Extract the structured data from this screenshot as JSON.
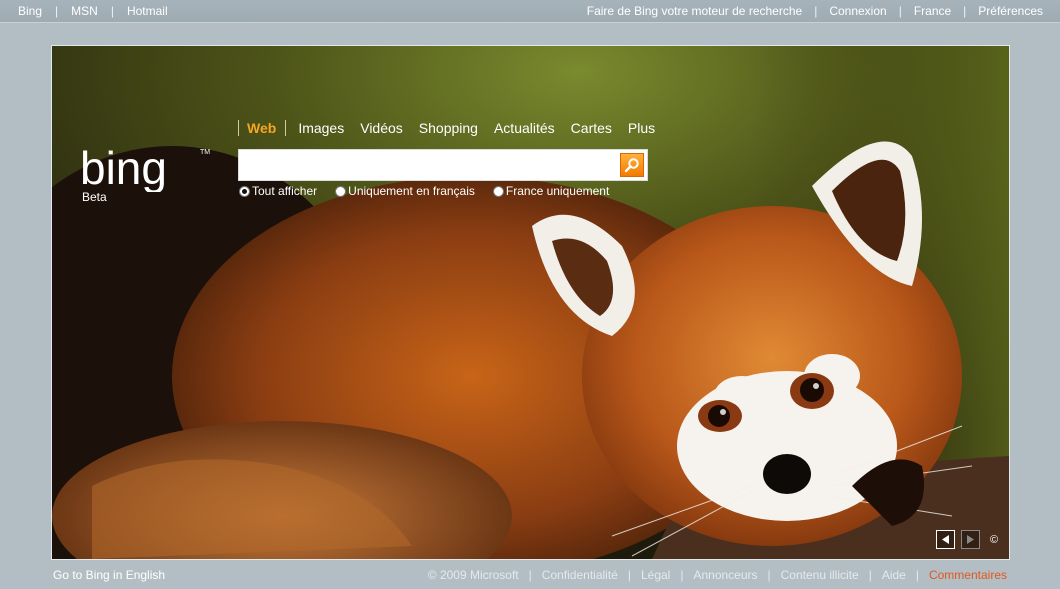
{
  "topbar": {
    "left_links": [
      "Bing",
      "MSN",
      "Hotmail"
    ],
    "right_links": [
      "Faire de Bing votre moteur de recherche",
      "Connexion",
      "France",
      "Préférences"
    ]
  },
  "logo": {
    "text": "bing",
    "beta": "Beta"
  },
  "nav": {
    "active": "Web",
    "tabs": [
      "Images",
      "Vidéos",
      "Shopping",
      "Actualités",
      "Cartes",
      "Plus"
    ]
  },
  "search": {
    "value": "",
    "placeholder": ""
  },
  "radios": [
    {
      "label": "Tout afficher",
      "checked": true
    },
    {
      "label": "Uniquement en français",
      "checked": false
    },
    {
      "label": "France uniquement",
      "checked": false
    }
  ],
  "image_controls": {
    "copyright_symbol": "©"
  },
  "footer": {
    "left_link": "Go to Bing in English",
    "links": [
      "© 2009 Microsoft",
      "Confidentialité",
      "Légal",
      "Annonceurs",
      "Contenu illicite",
      "Aide",
      "Commentaires"
    ]
  },
  "colors": {
    "accent": "#f5a623",
    "feedback": "#e2571e",
    "search_button": "#f28a00"
  },
  "icons": {
    "search": "magnifier-icon",
    "prev": "triangle-left-icon",
    "next": "triangle-right-icon"
  }
}
